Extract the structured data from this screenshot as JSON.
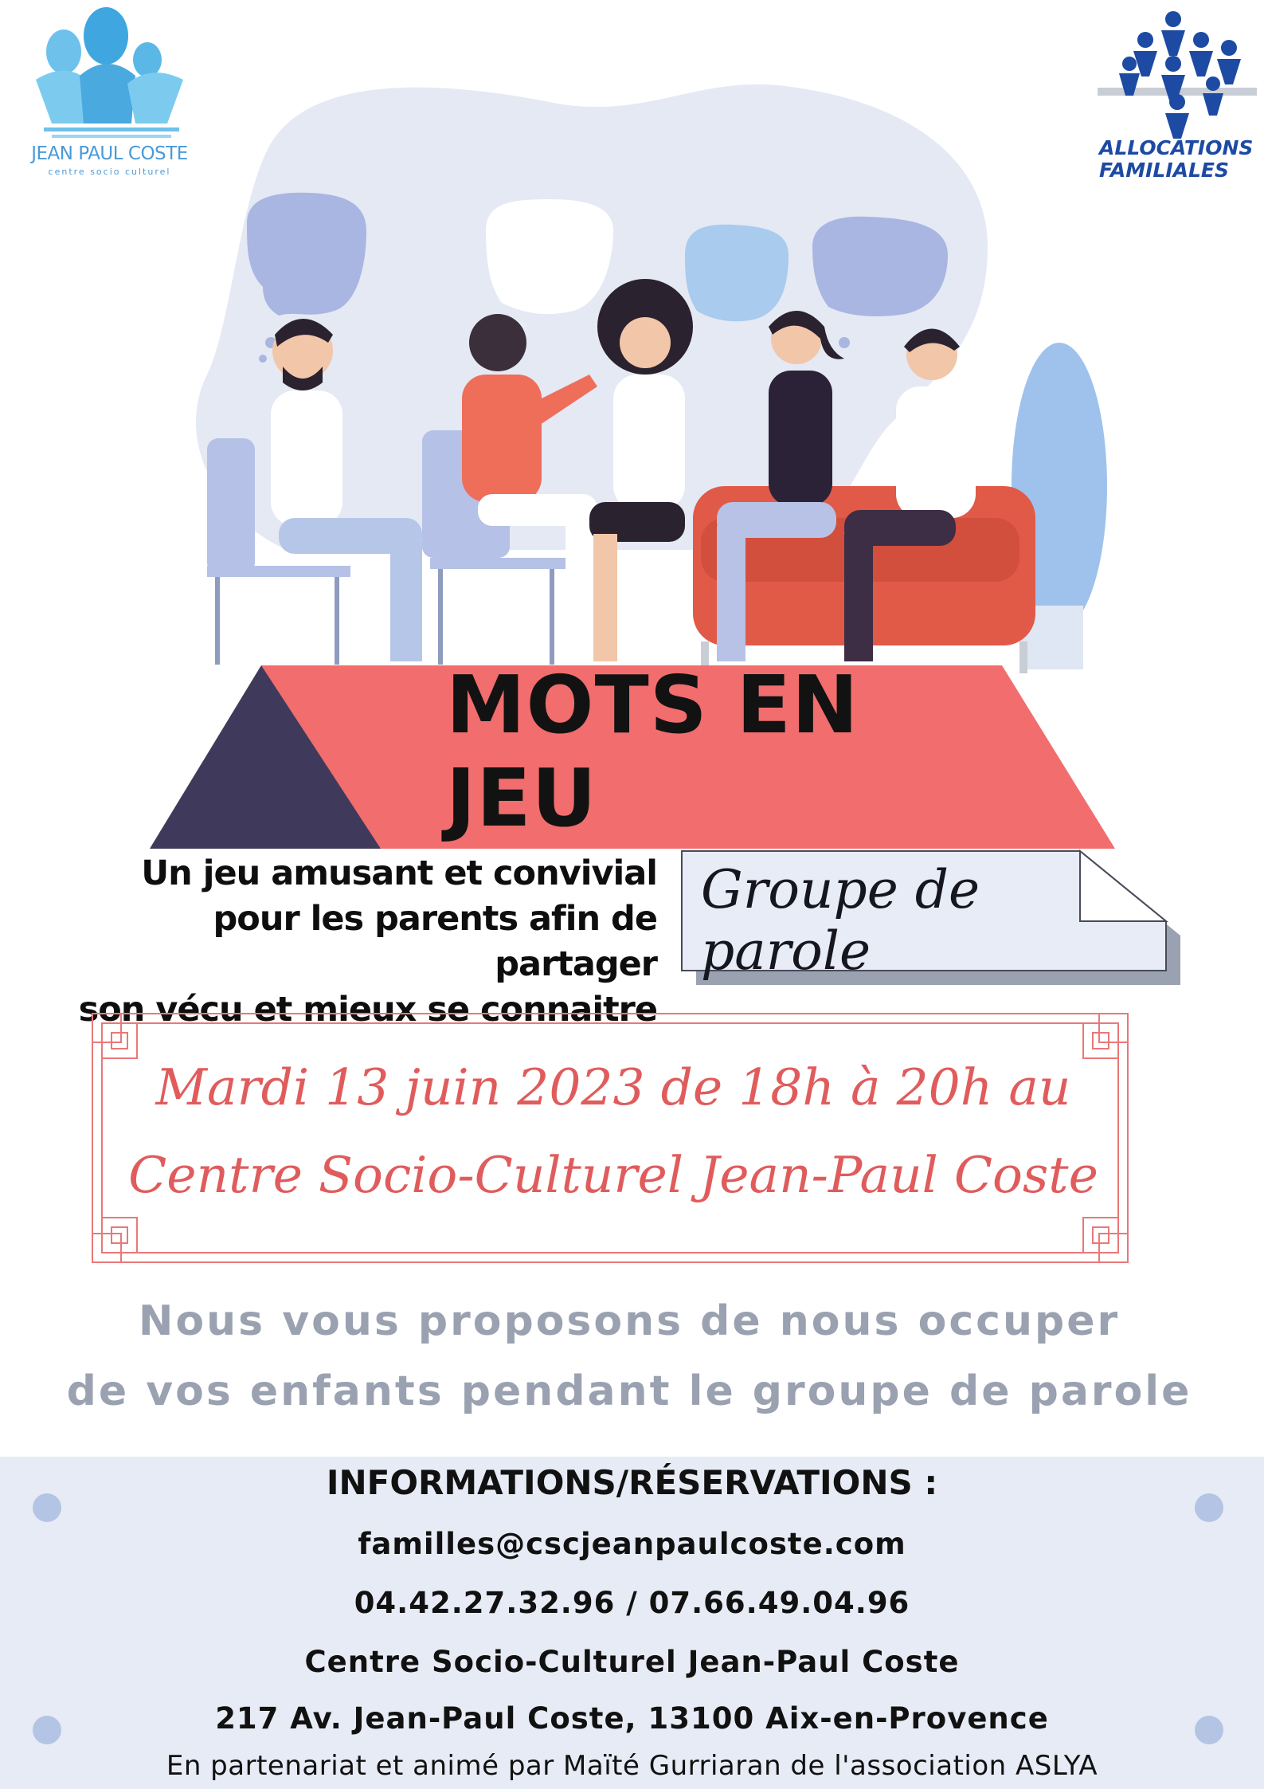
{
  "logos": {
    "left_name": "JEAN PAUL COSTE",
    "left_subtitle": "centre socio culturel",
    "right_line1": "ALLOCATIONS",
    "right_line2": "FAMILIALES"
  },
  "event": {
    "title": "MOTS EN JEU",
    "intro_lines": [
      "Un jeu amusant et convivial",
      "pour les parents afin de partager",
      "son vécu et mieux se connaitre"
    ],
    "tag": "Groupe de parole",
    "date_line1": "Mardi 13 juin 2023 de 18h à 20h au",
    "date_line2": "Centre Socio-Culturel Jean-Paul Coste"
  },
  "childcare": {
    "line1": "Nous vous proposons de nous occuper",
    "line2": "de vos enfants pendant le groupe de parole"
  },
  "info": {
    "heading": "INFORMATIONS/RÉSERVATIONS :",
    "email": "familles@cscjeanpaulcoste.com",
    "phone": "04.42.27.32.96 / 07.66.49.04.96",
    "center": "Centre Socio-Culturel Jean-Paul Coste",
    "address": "217 Av. Jean-Paul Coste, 13100 Aix-en-Provence",
    "partner": "En partenariat et animé par Maïté Gurriaran de l'association ASLYA"
  },
  "colors": {
    "banner": "#f26d6d",
    "banner_dark": "#3f3a5b",
    "date_text": "#e05c5c",
    "childcare_text": "#9aa1b0",
    "info_bg": "#e7ebf5",
    "logo_blue": "#4a9ad8",
    "caf_blue": "#1d4aa3"
  }
}
